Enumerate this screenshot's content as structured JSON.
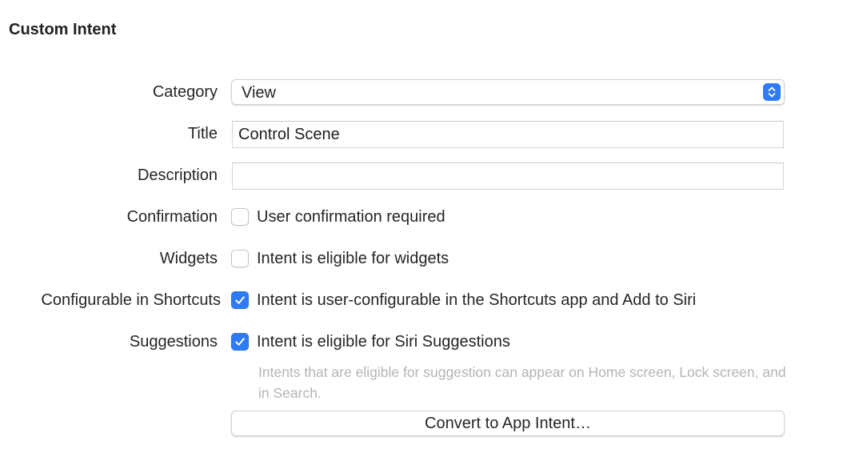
{
  "section": {
    "title": "Custom Intent"
  },
  "labels": {
    "category": "Category",
    "title": "Title",
    "description": "Description",
    "confirmation": "Confirmation",
    "widgets": "Widgets",
    "configurable": "Configurable in Shortcuts",
    "suggestions": "Suggestions"
  },
  "category": {
    "selected": "View"
  },
  "title_field": {
    "value": "Control Scene"
  },
  "description_field": {
    "value": ""
  },
  "confirmation": {
    "label": "User confirmation required",
    "checked": false
  },
  "widgets": {
    "label": "Intent is eligible for widgets",
    "checked": false
  },
  "configurable": {
    "label": "Intent is user-configurable in the Shortcuts app and Add to Siri",
    "checked": true
  },
  "suggestions": {
    "label": "Intent is eligible for Siri Suggestions",
    "checked": true,
    "hint": "Intents that are eligible for suggestion can appear on Home screen, Lock screen, and in Search."
  },
  "convert_button": {
    "label": "Convert to App Intent…"
  },
  "colors": {
    "accent": "#2f7bf6",
    "hint_text": "#b4b4b4"
  },
  "icons": {
    "popup_stepper": "chevron-up-down-icon",
    "checkmark": "checkmark-icon"
  }
}
